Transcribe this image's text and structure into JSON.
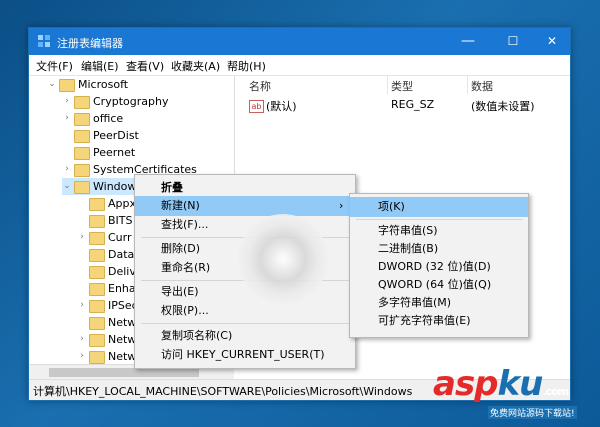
{
  "window": {
    "title": "注册表编辑器",
    "controls": {
      "minimize": "—",
      "maximize": "☐",
      "close": "✕"
    }
  },
  "menubar": [
    "文件(F)",
    "编辑(E)",
    "查看(V)",
    "收藏夹(A)",
    "帮助(H)"
  ],
  "tree": [
    {
      "label": "Microsoft",
      "expanded": true
    },
    {
      "label": "Cryptography"
    },
    {
      "label": "office"
    },
    {
      "label": "PeerDist"
    },
    {
      "label": "Peernet"
    },
    {
      "label": "SystemCertificates"
    },
    {
      "label": "Window",
      "expanded": true,
      "selected": true
    },
    {
      "label": "Appx"
    },
    {
      "label": "BITS"
    },
    {
      "label": "Curr"
    },
    {
      "label": "Data"
    },
    {
      "label": "Deliv"
    },
    {
      "label": "Enha"
    },
    {
      "label": "IPSec"
    },
    {
      "label": "Netw"
    },
    {
      "label": "Netw"
    },
    {
      "label": "Netw"
    }
  ],
  "values_pane": {
    "headers": [
      "名称",
      "类型",
      "数据"
    ],
    "rows": [
      {
        "name": "(默认)",
        "type": "REG_SZ",
        "data": "(数值未设置)",
        "icon": "ab"
      }
    ]
  },
  "context_menu": [
    {
      "label": "折叠",
      "bold": true
    },
    {
      "label": "新建(N)",
      "highlighted": true,
      "submenu_arrow": "›"
    },
    {
      "label": "查找(F)..."
    },
    {
      "label": "删除(D)"
    },
    {
      "label": "重命名(R)"
    },
    {
      "label": "导出(E)"
    },
    {
      "label": "权限(P)..."
    },
    {
      "label": "复制项名称(C)"
    },
    {
      "label": "访问 HKEY_CURRENT_USER(T)"
    }
  ],
  "submenu": [
    {
      "label": "项(K)",
      "highlighted": true
    },
    {
      "label": "字符串值(S)"
    },
    {
      "label": "二进制值(B)"
    },
    {
      "label": "DWORD (32 位)值(D)"
    },
    {
      "label": "QWORD (64 位)值(Q)"
    },
    {
      "label": "多字符串值(M)"
    },
    {
      "label": "可扩充字符串值(E)"
    }
  ],
  "statusbar": "计算机\\HKEY_LOCAL_MACHINE\\SOFTWARE\\Policies\\Microsoft\\Windows",
  "watermark": {
    "part1": "asp",
    "part2": "ku",
    "suffix": ".com",
    "subtitle": "免费网站源码下载站!"
  },
  "colors": {
    "accent": "#1a78d4",
    "highlight": "#91c9f7"
  }
}
